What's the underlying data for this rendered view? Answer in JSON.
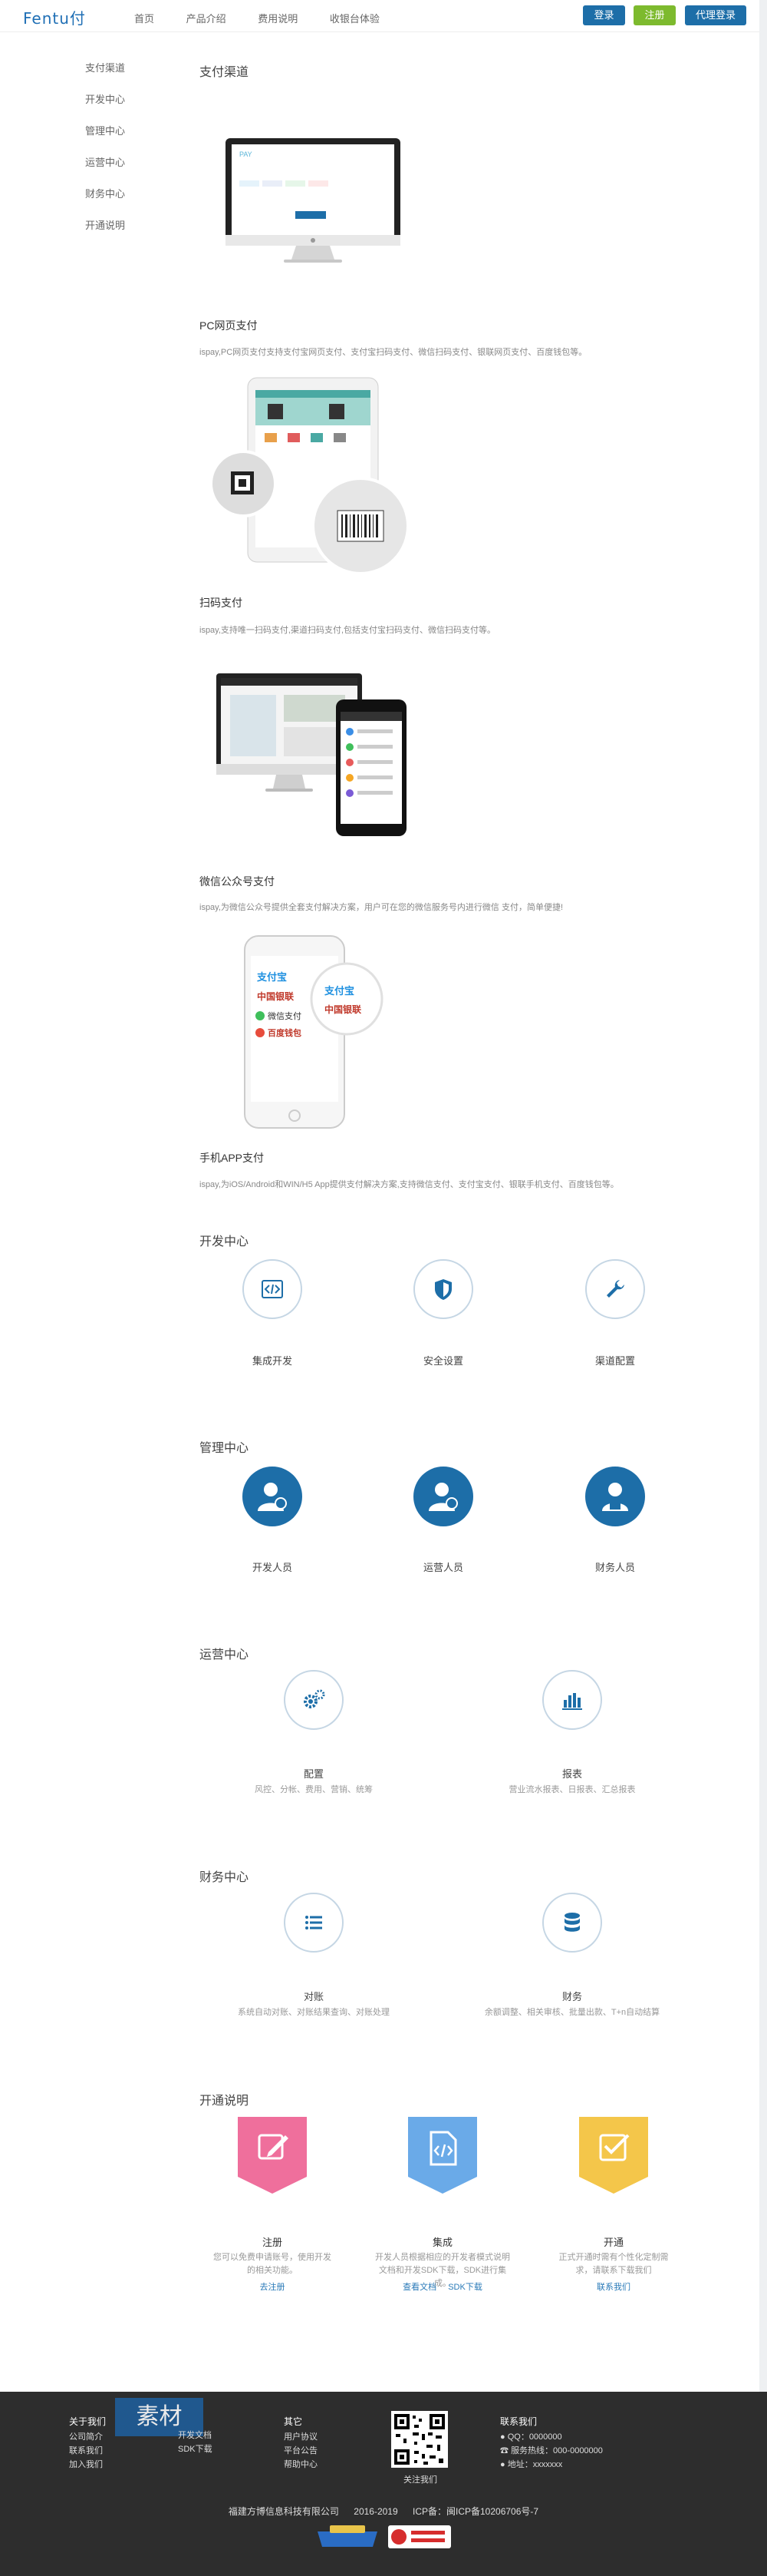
{
  "header": {
    "logo": "Fentu付",
    "nav": [
      "首页",
      "产品介绍",
      "费用说明",
      "收银台体验"
    ],
    "login": "登录",
    "register": "注册",
    "agent_login": "代理登录"
  },
  "sidebar": [
    "支付渠道",
    "开发中心",
    "管理中心",
    "运营中心",
    "财务中心",
    "开通说明"
  ],
  "sections": {
    "pay_channel_title": "支付渠道",
    "pc": {
      "title": "PC网页支付",
      "desc": "ispay,PC网页支付支持支付宝网页支付、支付宝扫码支付、微信扫码支付、银联网页支付、百度钱包等。"
    },
    "scan": {
      "title": "扫码支付",
      "desc": "ispay,支持唯一扫码支付,渠道扫码支付,包括支付宝扫码支付、微信扫码支付等。"
    },
    "wechat": {
      "title": "微信公众号支付",
      "desc": "ispay,为微信公众号提供全套支付解决方案，用户可在您的微信服务号内进行微信 支付，简单便捷!"
    },
    "app": {
      "title": "手机APP支付",
      "desc": "ispay,为iOS/Android和WIN/H5 App提供支付解决方案,支持微信支付、支付宝支付、银联手机支付、百度钱包等。"
    }
  },
  "dev": {
    "title": "开发中心",
    "items": [
      "集成开发",
      "安全设置",
      "渠道配置"
    ]
  },
  "manage": {
    "title": "管理中心",
    "items": [
      "开发人员",
      "运营人员",
      "财务人员"
    ]
  },
  "ops": {
    "title": "运营中心",
    "items": [
      {
        "label": "配置",
        "sub": "风控、分帐、费用、营销、统筹"
      },
      {
        "label": "报表",
        "sub": "营业流水报表、日报表、汇总报表"
      }
    ]
  },
  "finance": {
    "title": "财务中心",
    "items": [
      {
        "label": "对账",
        "sub": "系统自动对账、对账结果查询、对账处理"
      },
      {
        "label": "财务",
        "sub": "余额调整、相关审核、批量出款、T+n自动结算"
      }
    ]
  },
  "open": {
    "title": "开通说明",
    "items": [
      {
        "label": "注册",
        "desc": "您可以免费申请账号，使用开发的相关功能。",
        "links": [
          "去注册"
        ],
        "color": "#ef6f9c"
      },
      {
        "label": "集成",
        "desc": "开发人员根据相应的开发者模式说明文档和开发SDK下载，SDK进行集成。",
        "links": [
          "查看文档",
          "SDK下载"
        ],
        "color": "#6aaae8"
      },
      {
        "label": "开通",
        "desc": "正式开通时需有个性化定制需求，请联系下载我们",
        "links": [
          "联系我们"
        ],
        "color": "#f4c64a"
      }
    ]
  },
  "footer": {
    "about": {
      "title": "关于我们",
      "items": [
        "公司简介",
        "联系我们",
        "加入我们"
      ]
    },
    "docs": {
      "items": [
        "开发文档",
        "SDK下载"
      ]
    },
    "other": {
      "title": "其它",
      "items": [
        "用户协议",
        "平台公告",
        "帮助中心"
      ]
    },
    "qr_caption": "关注我们",
    "contact": {
      "title": "联系我们",
      "qq": "QQ：0000000",
      "phone": "服务热线：000-0000000",
      "address": "地址：xxxxxxx"
    },
    "company": "福建方博信息科技有限公司",
    "years": "2016-2019",
    "icp": "ICP备：闽ICP备10206706号-7",
    "watermark": "素材"
  }
}
